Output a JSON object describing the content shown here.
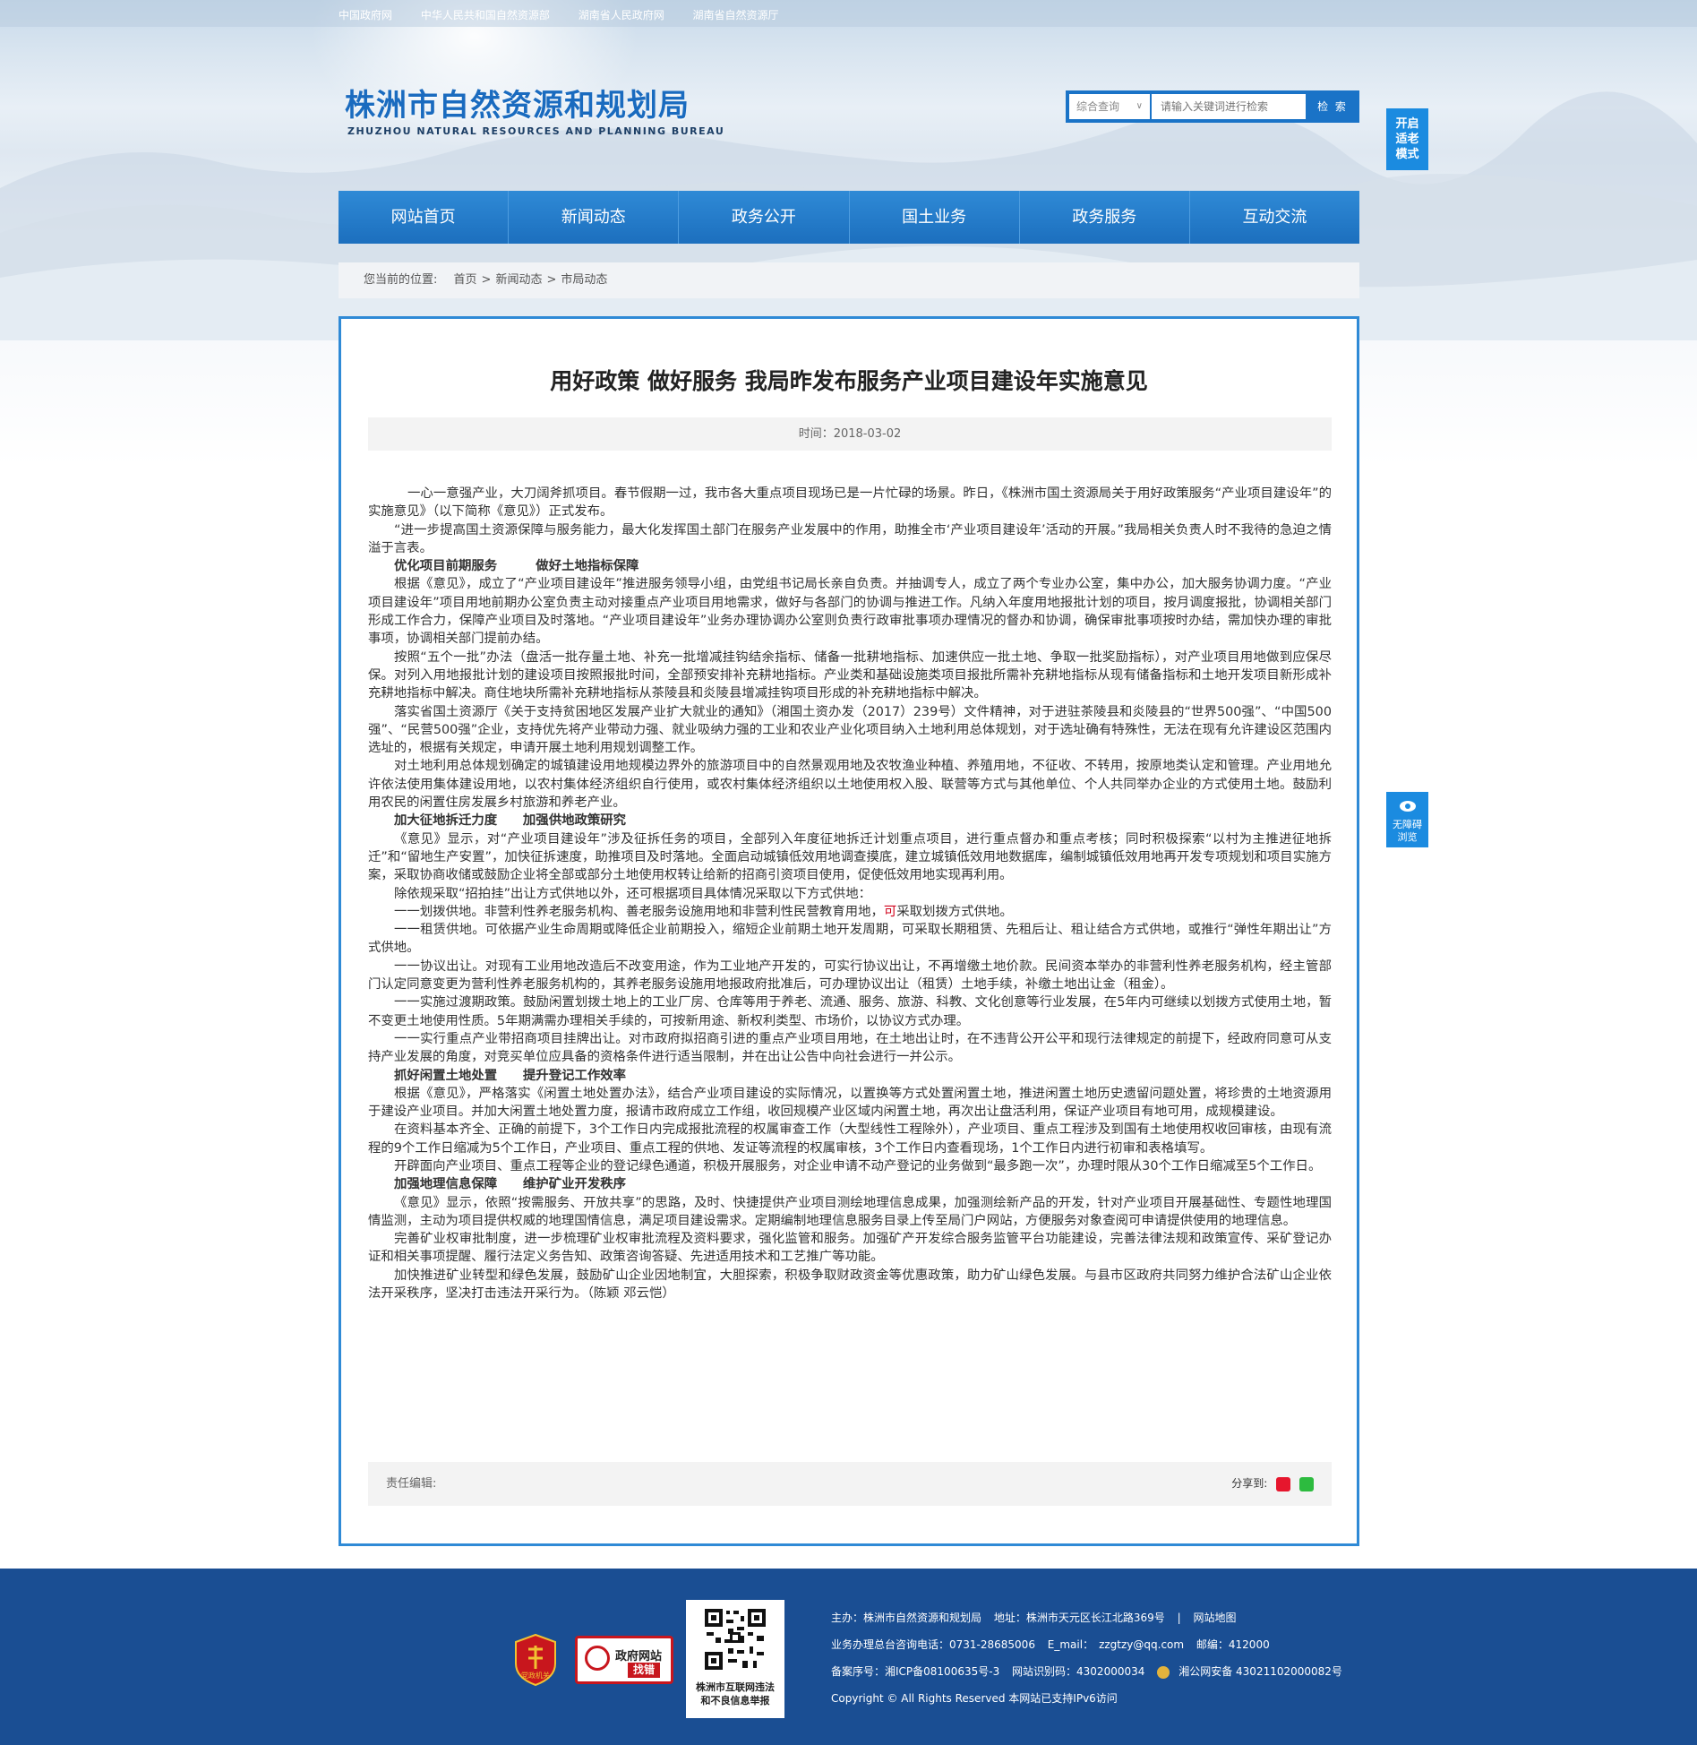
{
  "top_links": [
    "中国政府网",
    "中华人民共和国自然资源部",
    "湖南省人民政府网",
    "湖南省自然资源厅"
  ],
  "logo": {
    "cn": "株洲市自然资源和规划局",
    "en": "ZHUZHOU NATURAL RESOURCES AND PLANNING BUREAU"
  },
  "search": {
    "category": "综合查询",
    "placeholder": "请输入关键词进行检索",
    "button": "检 索"
  },
  "side": {
    "elder_mode": [
      "开启",
      "适老",
      "模式"
    ],
    "accessibility": [
      "无障碍",
      "浏览"
    ]
  },
  "nav": [
    "网站首页",
    "新闻动态",
    "政务公开",
    "国土业务",
    "政务服务",
    "互动交流"
  ],
  "breadcrumb": {
    "label": "您当前的位置:",
    "items": [
      "首页",
      "新闻动态",
      "市局动态"
    ]
  },
  "article": {
    "title": "用好政策 做好服务 我局昨发布服务产业项目建设年实施意见",
    "time": "时间：2018-03-02",
    "paragraphs": [
      {
        "type": "first",
        "text": "一心一意强产业，大刀阔斧抓项目。春节假期一过，我市各大重点项目现场已是一片忙碌的场景。昨日，《株洲市国土资源局关于用好政策服务“产业项目建设年”的实施意见》（以下简称《意见》）正式发布。"
      },
      {
        "type": "p",
        "text": "“进一步提高国土资源保障与服务能力，最大化发挥国土部门在服务产业发展中的作用，助推全市‘产业项目建设年’活动的开展。”我局相关负责人时不我待的急迫之情溢于言表。"
      },
      {
        "type": "sub",
        "text": "优化项目前期服务　　　做好土地指标保障"
      },
      {
        "type": "p",
        "text": "根据《意见》，成立了“产业项目建设年”推进服务领导小组，由党组书记局长亲自负责。并抽调专人，成立了两个专业办公室，集中办公，加大服务协调力度。“产业项目建设年”项目用地前期办公室负责主动对接重点产业项目用地需求，做好与各部门的协调与推进工作。凡纳入年度用地报批计划的项目，按月调度报批，协调相关部门形成工作合力，保障产业项目及时落地。“产业项目建设年”业务办理协调办公室则负责行政审批事项办理情况的督办和协调，确保审批事项按时办结，需加快办理的审批事项，协调相关部门提前办结。"
      },
      {
        "type": "p",
        "text": "按照“五个一批”办法（盘活一批存量土地、补充一批增减挂钩结余指标、储备一批耕地指标、加速供应一批土地、争取一批奖励指标），对产业项目用地做到应保尽保。对列入用地报批计划的建设项目按照报批时间，全部预安排补充耕地指标。产业类和基础设施类项目报批所需补充耕地指标从现有储备指标和土地开发项目新形成补充耕地指标中解决。商住地块所需补充耕地指标从茶陵县和炎陵县增减挂钩项目形成的补充耕地指标中解决。"
      },
      {
        "type": "p",
        "text": "落实省国土资源厅《关于支持贫困地区发展产业扩大就业的通知》（湘国土资办发（2017）239号）文件精神，对于进驻茶陵县和炎陵县的“世界500强”、“中国500强”、“民营500强”企业，支持优先将产业带动力强、就业吸纳力强的工业和农业产业化项目纳入土地利用总体规划，对于选址确有特殊性，无法在现有允许建设区范围内选址的，根据有关规定，申请开展土地利用规划调整工作。"
      },
      {
        "type": "p",
        "text": "对土地利用总体规划确定的城镇建设用地规模边界外的旅游项目中的自然景观用地及农牧渔业种植、养殖用地，不征收、不转用，按原地类认定和管理。产业用地允许依法使用集体建设用地，以农村集体经济组织自行使用，或农村集体经济组织以土地使用权入股、联营等方式与其他单位、个人共同举办企业的方式使用土地。鼓励利用农民的闲置住房发展乡村旅游和养老产业。"
      },
      {
        "type": "sub",
        "text": "加大征地拆迁力度　　加强供地政策研究"
      },
      {
        "type": "p",
        "text": "《意见》显示，对“产业项目建设年”涉及征拆任务的项目，全部列入年度征地拆迁计划重点项目，进行重点督办和重点考核；同时积极探索“以村为主推进征地拆迁”和“留地生产安置”，加快征拆速度，助推项目及时落地。全面启动城镇低效用地调查摸底，建立城镇低效用地数据库，编制城镇低效用地再开发专项规划和项目实施方案，采取协商收储或鼓励企业将全部或部分土地使用权转让给新的招商引资项目使用，促使低效用地实现再利用。"
      },
      {
        "type": "p",
        "text": "除依规采取“招拍挂”出让方式供地以外，还可根据项目具体情况采取以下方式供地："
      },
      {
        "type": "p_red",
        "pre": "一一划拨供地。非营利性养老服务机构、善老服务设施用地和非营利性民营教育用地，",
        "red": "可",
        "post": "采取划拨方式供地。"
      },
      {
        "type": "p",
        "text": "一一租赁供地。可依据产业生命周期或降低企业前期投入，缩短企业前期土地开发周期，可采取长期租赁、先租后让、租让结合方式供地，或推行“弹性年期出让”方式供地。"
      },
      {
        "type": "p",
        "text": "一一协议出让。对现有工业用地改造后不改变用途，作为工业地产开发的，可实行协议出让，不再增缴土地价款。民间资本举办的非营利性养老服务机构，经主管部门认定同意变更为营利性养老服务机构的，其养老服务设施用地报政府批准后，可办理协议出让（租赁）土地手续，补缴土地出让金（租金）。"
      },
      {
        "type": "p",
        "text": "一一实施过渡期政策。鼓励闲置划拨土地上的工业厂房、仓库等用于养老、流通、服务、旅游、科教、文化创意等行业发展，在5年内可继续以划拨方式使用土地，暂不变更土地使用性质。5年期满需办理相关手续的，可按新用途、新权利类型、市场价，以协议方式办理。"
      },
      {
        "type": "p",
        "text": "一一实行重点产业带招商项目挂牌出让。对市政府拟招商引进的重点产业项目用地，在土地出让时，在不违背公开公平和现行法律规定的前提下，经政府同意可从支持产业发展的角度，对竞买单位应具备的资格条件进行适当限制，并在出让公告中向社会进行一并公示。"
      },
      {
        "type": "sub",
        "text": "抓好闲置土地处置　　提升登记工作效率"
      },
      {
        "type": "p",
        "text": "根据《意见》，严格落实《闲置土地处置办法》，结合产业项目建设的实际情况，以置换等方式处置闲置土地，推进闲置土地历史遗留问题处置，将珍贵的土地资源用于建设产业项目。并加大闲置土地处置力度，报请市政府成立工作组，收回规模产业区域内闲置土地，再次出让盘活利用，保证产业项目有地可用，成规模建设。"
      },
      {
        "type": "p",
        "text": "在资料基本齐全、正确的前提下，3个工作日内完成报批流程的权属审查工作（大型线性工程除外），产业项目、重点工程涉及到国有土地使用权收回审核，由现有流程的9个工作日缩减为5个工作日，产业项目、重点工程的供地、发证等流程的权属审核，3个工作日内查看现场，1个工作日内进行初审和表格填写。"
      },
      {
        "type": "p",
        "text": "开辟面向产业项目、重点工程等企业的登记绿色通道，积极开展服务，对企业申请不动产登记的业务做到“最多跑一次”，办理时限从30个工作日缩减至5个工作日。"
      },
      {
        "type": "sub",
        "text": "加强地理信息保障　　维护矿业开发秩序"
      },
      {
        "type": "p",
        "text": "《意见》显示，依照“按需服务、开放共享”的思路，及时、快捷提供产业项目测绘地理信息成果，加强测绘新产品的开发，针对产业项目开展基础性、专题性地理国情监测，主动为项目提供权威的地理国情信息，满足项目建设需求。定期编制地理信息服务目录上传至局门户网站，方便服务对象查阅可申请提供使用的地理信息。"
      },
      {
        "type": "p",
        "text": "完善矿业权审批制度，进一步梳理矿业权审批流程及资料要求，强化监管和服务。加强矿产开发综合服务监管平台功能建设，完善法律法规和政策宣传、采矿登记办证和相关事项提醒、履行法定义务告知、政策咨询答疑、先进适用技术和工艺推广等功能。"
      },
      {
        "type": "p",
        "text": "加快推进矿业转型和绿色发展，鼓励矿山企业因地制宜，大胆探索，积极争取财政资金等优惠政策，助力矿山绿色发展。与县市区政府共同努力维护合法矿山企业依法开采秩序，坚决打击违法开采行为。（陈颖 邓云恺）"
      }
    ],
    "editor": "责任编辑:",
    "share": "分享到:"
  },
  "footer": {
    "badge1": "党政机关",
    "badge2": {
      "t1": "政府网站",
      "t2": "找错"
    },
    "qr_caption": [
      "株洲市互联网违法",
      "和不良信息举报"
    ],
    "rows": [
      [
        "主办：株洲市自然资源和规划局",
        "地址：株洲市天元区长江北路369号",
        "|",
        "网站地图"
      ],
      [
        "业务办理总台咨询电话：0731-28685006",
        "E_mail：　zzgtzy@qq.com",
        "邮编：412000"
      ],
      [
        "备案序号：湘ICP备08100635号-3",
        "网站识别码：4302000034",
        "湘公网安备 43021102000082号"
      ],
      [
        "Copyright © All Rights Reserved 本网站已支持IPv6访问"
      ]
    ]
  },
  "colors": {
    "primary": "#1c6fbe",
    "accent_light": "#2f8ad6",
    "footer": "#1a4e93",
    "red": "#d0021b"
  }
}
